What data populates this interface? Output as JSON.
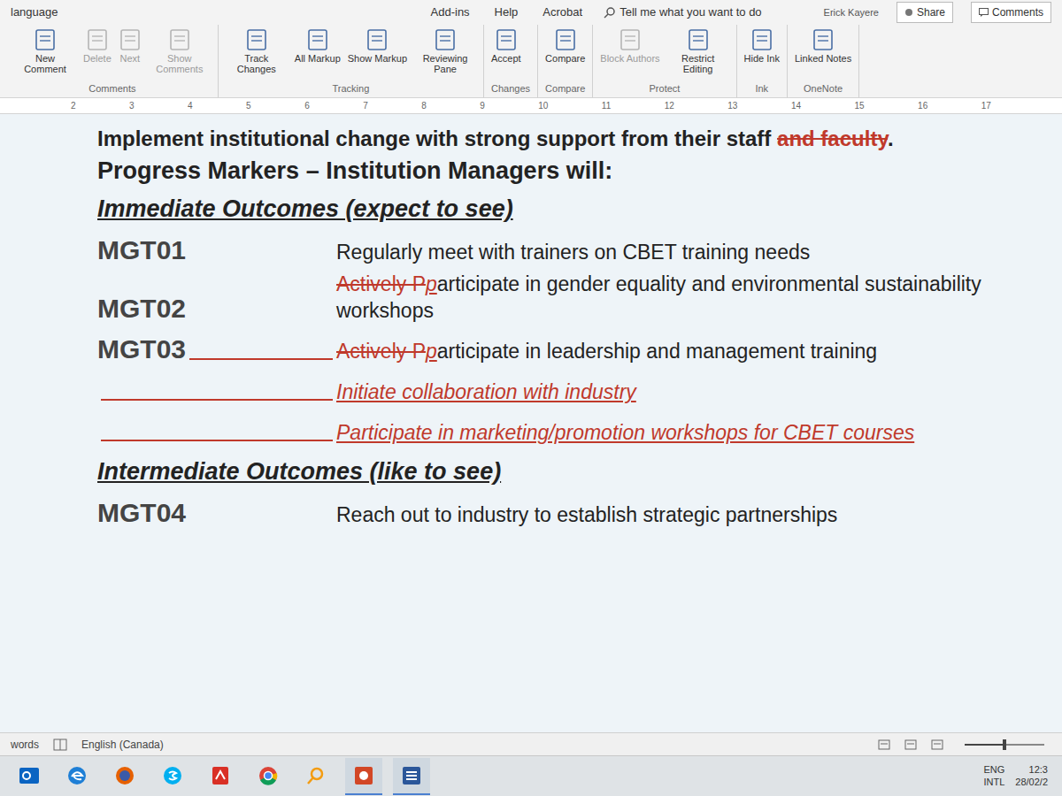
{
  "ribbon": {
    "left_label": "language",
    "tabs": [
      "Add-ins",
      "Help",
      "Acrobat"
    ],
    "tell_me": "Tell me what you want to do",
    "user": "Erick Kayere",
    "share": "Share",
    "comments": "Comments",
    "groups": [
      {
        "label": "Comments",
        "buttons": [
          {
            "text": "New Comment",
            "disabled": false
          },
          {
            "text": "Delete",
            "disabled": true
          },
          {
            "text": "Next",
            "disabled": true
          },
          {
            "text": "Show Comments",
            "disabled": true
          }
        ]
      },
      {
        "label": "Tracking",
        "buttons": [
          {
            "text": "Track Changes",
            "disabled": false
          },
          {
            "text": "All Markup",
            "disabled": false
          },
          {
            "text": "Show Markup",
            "disabled": false
          },
          {
            "text": "Reviewing Pane",
            "disabled": false
          }
        ]
      },
      {
        "label": "Changes",
        "buttons": [
          {
            "text": "Accept",
            "disabled": false
          }
        ]
      },
      {
        "label": "Compare",
        "buttons": [
          {
            "text": "Compare",
            "disabled": false
          }
        ]
      },
      {
        "label": "Protect",
        "buttons": [
          {
            "text": "Block Authors",
            "disabled": true
          },
          {
            "text": "Restrict Editing",
            "disabled": false
          }
        ]
      },
      {
        "label": "Ink",
        "buttons": [
          {
            "text": "Hide Ink",
            "disabled": false
          }
        ]
      },
      {
        "label": "OneNote",
        "buttons": [
          {
            "text": "Linked Notes",
            "disabled": false
          }
        ]
      }
    ]
  },
  "ruler": [
    "2",
    "3",
    "4",
    "5",
    "6",
    "7",
    "8",
    "9",
    "10",
    "11",
    "12",
    "13",
    "14",
    "15",
    "16",
    "17"
  ],
  "document": {
    "intro": [
      {
        "text": "Implement institutional change with strong support from their staff ",
        "kind": "plain"
      },
      {
        "text": "and faculty",
        "kind": "deleted"
      },
      {
        "text": ".",
        "kind": "plain"
      }
    ],
    "title": "Progress Markers – Institution Managers will:",
    "sections": [
      {
        "heading": "Immediate Outcomes (expect to see)",
        "rows": [
          {
            "code": "MGT01",
            "changed": false,
            "runs": [
              {
                "text": "Regularly meet with trainers on CBET training needs",
                "kind": "plain"
              }
            ]
          },
          {
            "code": "MGT02",
            "changed": false,
            "runs": [
              {
                "text": "Actively P",
                "kind": "deleted"
              },
              {
                "text": "p",
                "kind": "inserted"
              },
              {
                "text": "articipate in gender equality and environmental sustainability workshops",
                "kind": "plain"
              }
            ]
          },
          {
            "code": "MGT03",
            "changed": true,
            "runs": [
              {
                "text": "Actively P",
                "kind": "deleted"
              },
              {
                "text": "p",
                "kind": "inserted"
              },
              {
                "text": "articipate in leadership and management training",
                "kind": "plain"
              }
            ]
          },
          {
            "changed": true,
            "runs": [
              {
                "text": "Initiate collaboration with industry",
                "kind": "inserted"
              }
            ]
          },
          {
            "changed": true,
            "runs": [
              {
                "text": "Participate in marketing/promotion workshops for CBET courses",
                "kind": "inserted"
              }
            ]
          }
        ]
      },
      {
        "heading": "Intermediate Outcomes (like to see)",
        "rows": [
          {
            "code": "MGT04",
            "changed": false,
            "runs": [
              {
                "text": "Reach out to industry to establish strategic partnerships",
                "kind": "plain"
              }
            ]
          }
        ]
      }
    ]
  },
  "status_bar": {
    "words": "words",
    "language": "English (Canada)",
    "zoom": {
      "level": 0.5
    }
  },
  "taskbar": {
    "apps": [
      {
        "kind": "outlook",
        "selected": false
      },
      {
        "kind": "edge",
        "selected": false
      },
      {
        "kind": "firefox",
        "selected": false
      },
      {
        "kind": "skype",
        "selected": false
      },
      {
        "kind": "acrobat",
        "selected": false
      },
      {
        "kind": "chrome",
        "selected": false
      },
      {
        "kind": "search",
        "selected": false
      },
      {
        "kind": "powerpoint",
        "selected": true
      },
      {
        "kind": "word",
        "selected": true
      }
    ],
    "tray": {
      "lang1": "ENG",
      "lang2": "INTL",
      "time": "12:3",
      "date": "28/02/2"
    }
  }
}
